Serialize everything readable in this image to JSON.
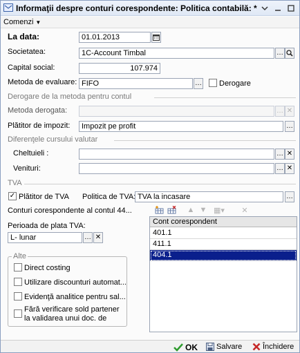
{
  "window": {
    "title": "Informaţii despre conturi corespondente: Politica contabilă: *"
  },
  "menu": {
    "comenzi": "Comenzi"
  },
  "form": {
    "la_data": {
      "label": "La data:",
      "value": "01.01.2013"
    },
    "societatea": {
      "label": "Societatea:",
      "value": "1C-Account Timbal"
    },
    "capital_social": {
      "label": "Capital social:",
      "value": "107.974"
    },
    "metoda_evaluare": {
      "label": "Metoda de evaluare:",
      "value": "FIFO"
    },
    "derogare": {
      "label": "Derogare"
    }
  },
  "sections": {
    "derogare": "Derogare de la metoda pentru contul",
    "diferente": "Diferenţele cursului valutar",
    "tva": "TVA",
    "alte": "Alte"
  },
  "derogare_section": {
    "metoda_derogata": {
      "label": "Metoda derogata:",
      "value": ""
    },
    "platitor_impozit": {
      "label": "Plătitor de impozit:",
      "value": "Impozit pe profit"
    }
  },
  "diferente_section": {
    "cheltuieli": {
      "label": "Cheltuieli :",
      "value": ""
    },
    "venituri": {
      "label": "Venituri:",
      "value": ""
    }
  },
  "tva_section": {
    "platitor_tva": {
      "label": "Plătitor de TVA",
      "checked": true
    },
    "politica_tva": {
      "label": "Politica de TVA:",
      "value": "TVA la incasare"
    },
    "conturi_label": "Conturi corespondente al contul 44...",
    "perioada": {
      "label": "Perioada de plata TVA:",
      "value": "L- lunar"
    }
  },
  "grid": {
    "header": "Cont corespondent",
    "rows": [
      "401.1",
      "411.1",
      "404.1"
    ],
    "selected_index": 2
  },
  "alte_section": {
    "items": [
      "Direct costing",
      "Utilizare discounturi automat...",
      "Evidenţă analitice pentru sal...",
      "Fără verificare sold partener la validarea unui doc. de"
    ]
  },
  "bottom": {
    "ok": "OK",
    "salvare": "Salvare",
    "inchidere": "Închidere"
  },
  "colors": {
    "selection": "#0a1f8c",
    "ok_green": "#2e9b2e",
    "close_red": "#c62828"
  }
}
